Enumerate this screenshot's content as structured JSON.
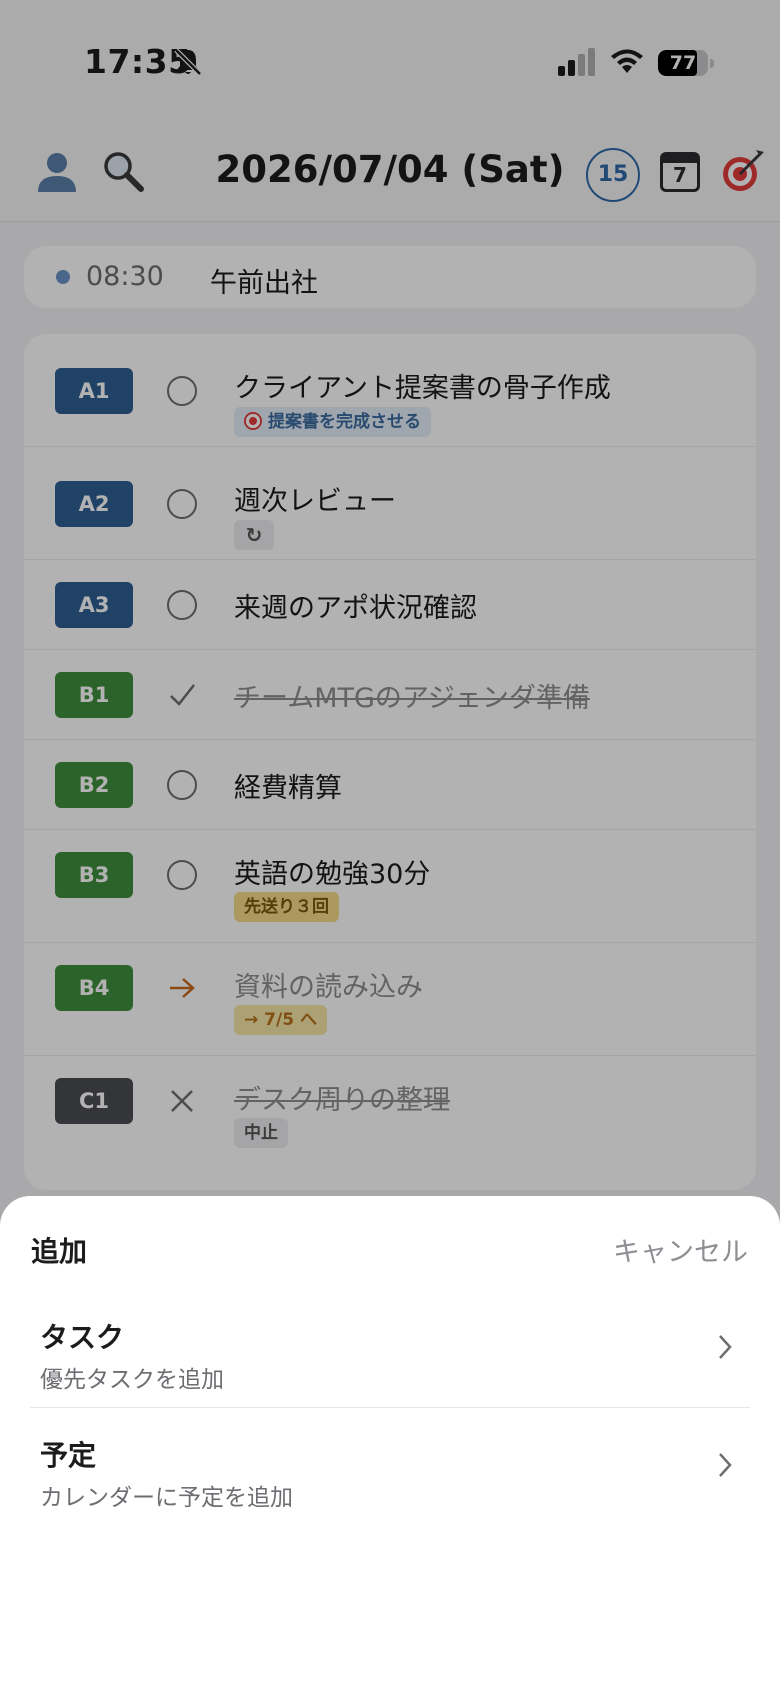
{
  "status_bar": {
    "time": "17:35",
    "battery": "77",
    "battery_level": 0.77
  },
  "header": {
    "date": "2026/07/04 (Sat)",
    "count_badge": "15",
    "calendar_day": "7",
    "icons": [
      "person-icon",
      "search-icon",
      "calendar-icon",
      "target-icon"
    ]
  },
  "event": {
    "time": "08:30",
    "title": "午前出社",
    "dot_color": "#6b93c7"
  },
  "tasks": [
    {
      "priority": "A1",
      "color": "#2e5f94",
      "status": "open",
      "title": "クライアント提案書の骨子作成",
      "tag": "提案書を完成させる",
      "tag_type": "goal"
    },
    {
      "priority": "A2",
      "color": "#2e5f94",
      "status": "open",
      "title": "週次レビュー",
      "tag": "↻",
      "tag_type": "repeat"
    },
    {
      "priority": "A3",
      "color": "#2e5f94",
      "status": "open",
      "title": "来週のアポ状況確認"
    },
    {
      "priority": "B1",
      "color": "#3f8f3d",
      "status": "done",
      "title": "チームMTGのアジェンダ準備"
    },
    {
      "priority": "B2",
      "color": "#3f8f3d",
      "status": "open",
      "title": "経費精算"
    },
    {
      "priority": "B3",
      "color": "#3f8f3d",
      "status": "open",
      "title": "英語の勉強30分",
      "tag": "先送り３回",
      "tag_type": "postpone"
    },
    {
      "priority": "B4",
      "color": "#3f8f3d",
      "status": "moved",
      "title": "資料の読み込み",
      "tag": "→ 7/5 へ",
      "tag_type": "moved"
    },
    {
      "priority": "C1",
      "color": "#4a4c52",
      "status": "cancelled",
      "title": "デスク周りの整理",
      "tag": "中止",
      "tag_type": "cancel"
    }
  ],
  "sheet": {
    "title": "追加",
    "cancel": "キャンセル",
    "options": [
      {
        "title": "タスク",
        "subtitle": "優先タスクを追加"
      },
      {
        "title": "予定",
        "subtitle": "カレンダーに予定を追加"
      }
    ]
  }
}
